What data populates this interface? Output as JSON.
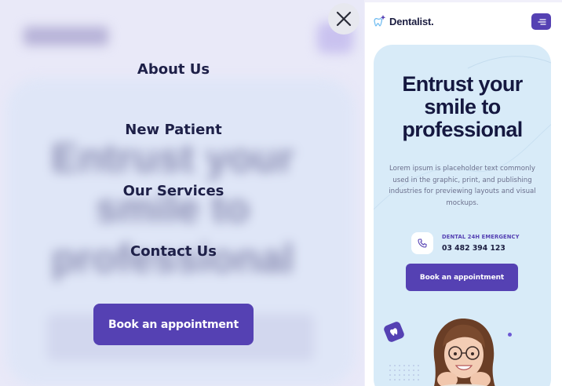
{
  "menu": {
    "items": [
      {
        "label": "About Us"
      },
      {
        "label": "New Patient"
      },
      {
        "label": "Our Services"
      },
      {
        "label": "Contact Us"
      }
    ],
    "cta_label": "Book an appointment",
    "close_icon": "close-icon"
  },
  "background_page": {
    "headline": "Entrust your smile to professional"
  },
  "mobile": {
    "brand": "Dentalist.",
    "hero": {
      "title": "Entrust your smile to professional",
      "description": "Lorem ipsum is placeholder text commonly used in the graphic, print, and publishing industries for previewing layouts and visual mockups.",
      "emergency_label": "DENTAL 24H EMERGENCY",
      "emergency_phone": "03 482 394 123",
      "cta_label": "Book an appointment"
    },
    "icons": [
      "tooth-logo-icon",
      "hamburger-menu-icon",
      "phone-icon",
      "tooth-badge-icon"
    ]
  },
  "colors": {
    "accent": "#5541b3",
    "heading": "#1b1d40",
    "hero_bg": "#d8ebf8",
    "overlay_bg": "#e9e9f8"
  }
}
